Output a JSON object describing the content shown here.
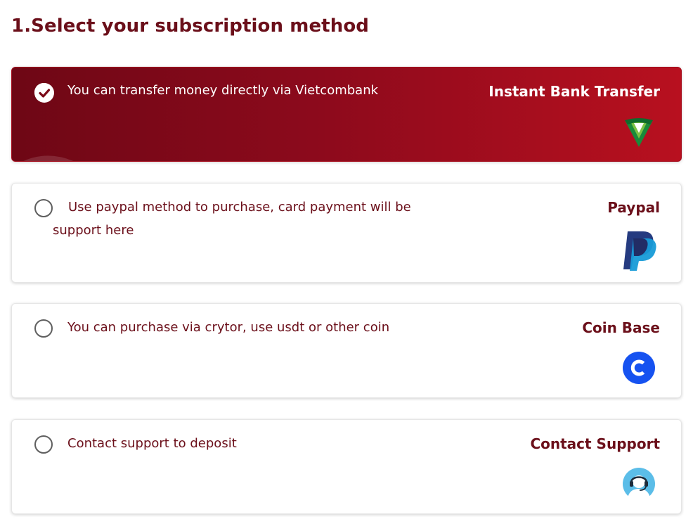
{
  "header": {
    "title": "1.Select your subscription method"
  },
  "methods": [
    {
      "name": "Instant Bank Transfer",
      "description": "You can transfer money directly via Vietcombank",
      "selected": true,
      "icon": "vietcombank-logo"
    },
    {
      "name": "Paypal",
      "description": "Use paypal method to purchase, card payment will be support here",
      "selected": false,
      "icon": "paypal-logo"
    },
    {
      "name": "Coin Base",
      "description": "You can purchase via crytor, use usdt or other coin",
      "selected": false,
      "icon": "coinbase-logo"
    },
    {
      "name": "Contact Support",
      "description": "Contact support to deposit",
      "selected": false,
      "icon": "support-agent-icon"
    }
  ],
  "colors": {
    "brand": "#6b0f1a",
    "selected_gradient_start": "#6e0715",
    "selected_gradient_end": "#b8101f",
    "paypal_dark": "#253b80",
    "paypal_light": "#179bd7",
    "coinbase_blue": "#1652f0",
    "vietcombank_green": "#1a8a3a"
  }
}
